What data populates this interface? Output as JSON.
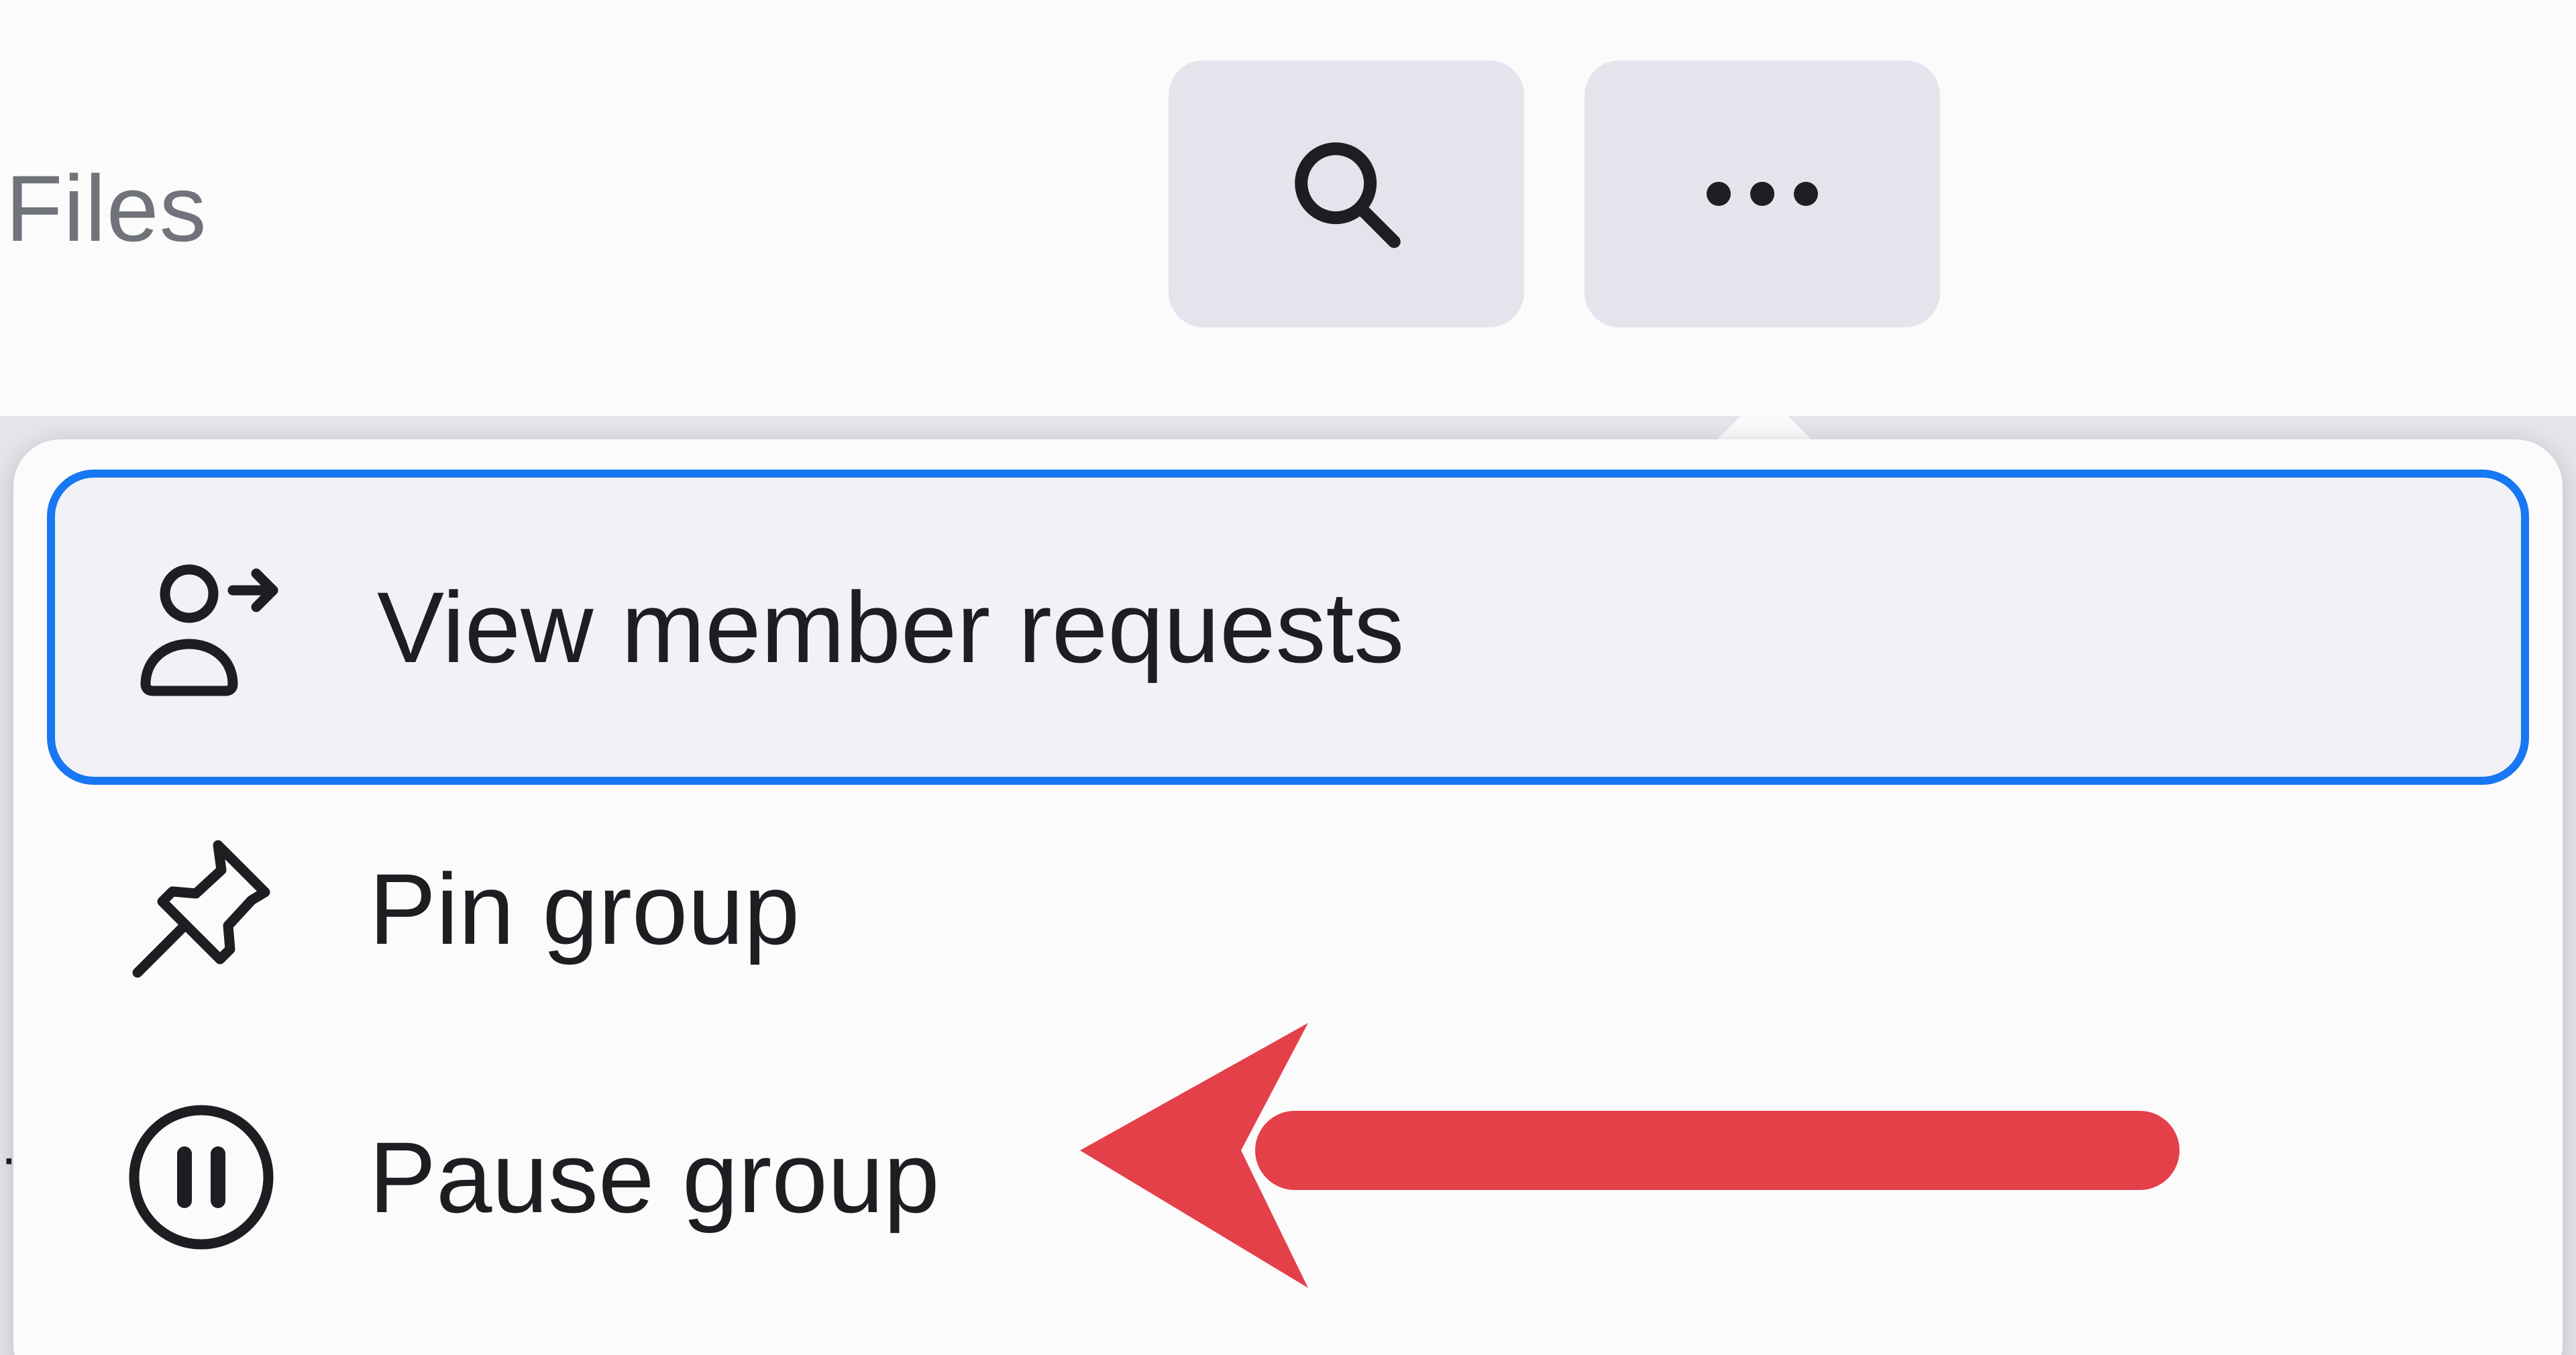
{
  "header": {
    "files_tab": "Files",
    "search_button": {
      "icon": "search-icon"
    },
    "more_button": {
      "icon": "more-horizontal-icon"
    }
  },
  "menu": {
    "items": [
      {
        "label": "View member requests",
        "icon": "person-arrow-icon",
        "focused": true
      },
      {
        "label": "Pin group",
        "icon": "pin-icon",
        "focused": false
      },
      {
        "label": "Pause group",
        "icon": "pause-circle-icon",
        "focused": false
      }
    ]
  },
  "annotation": {
    "type": "arrow",
    "color": "#e4404a",
    "points_to": "Pause group"
  },
  "colors": {
    "focus_ring": "#1877f2",
    "button_bg": "#e4e4ec",
    "text_primary": "#1c1e21",
    "text_secondary": "#707379"
  }
}
